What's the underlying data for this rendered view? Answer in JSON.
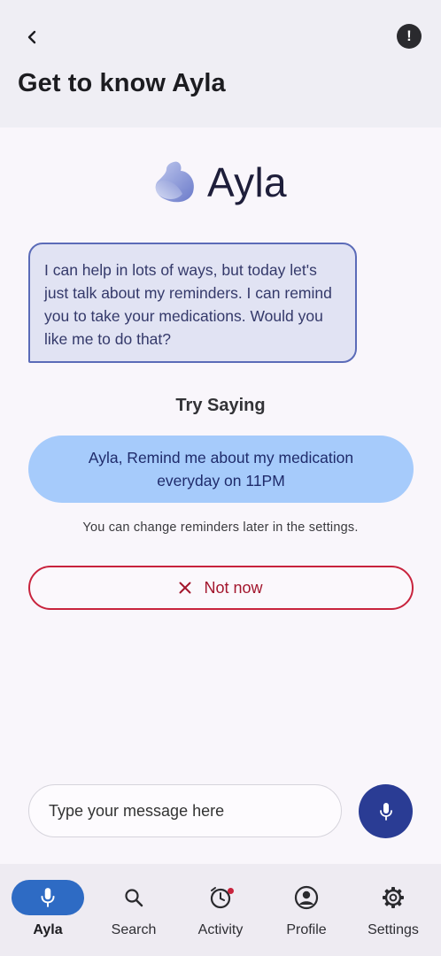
{
  "header": {
    "title": "Get to know Ayla",
    "back_icon": "chevron-left-icon",
    "info_icon": "info-alert-icon",
    "info_glyph": "!"
  },
  "brand": {
    "name": "Ayla"
  },
  "assistant_message": "I can help in lots of ways, but today let's just talk about my reminders. I can remind you to take your medications. Would you like me to do that?",
  "try_saying": {
    "heading": "Try Saying",
    "suggestion": "Ayla, Remind me about my medication everyday on 11PM"
  },
  "hint": "You can change reminders later in the settings.",
  "dismiss_button": {
    "label": "Not now",
    "icon": "close-icon"
  },
  "composer": {
    "placeholder": "Type your message here",
    "mic_icon": "microphone-icon"
  },
  "bottom_nav": {
    "items": [
      {
        "label": "Ayla",
        "icon": "microphone-icon",
        "active": true
      },
      {
        "label": "Search",
        "icon": "search-icon",
        "active": false
      },
      {
        "label": "Activity",
        "icon": "alarm-clock-icon",
        "active": false,
        "badge": true
      },
      {
        "label": "Profile",
        "icon": "account-circle-icon",
        "active": false
      },
      {
        "label": "Settings",
        "icon": "gear-icon",
        "active": false
      }
    ]
  },
  "colors": {
    "primary": "#2a3c94",
    "nav_active": "#2e6bc4",
    "bubble_bg": "#e1e3f3",
    "suggestion_bg": "#a6cbfb",
    "danger": "#c8233d"
  }
}
